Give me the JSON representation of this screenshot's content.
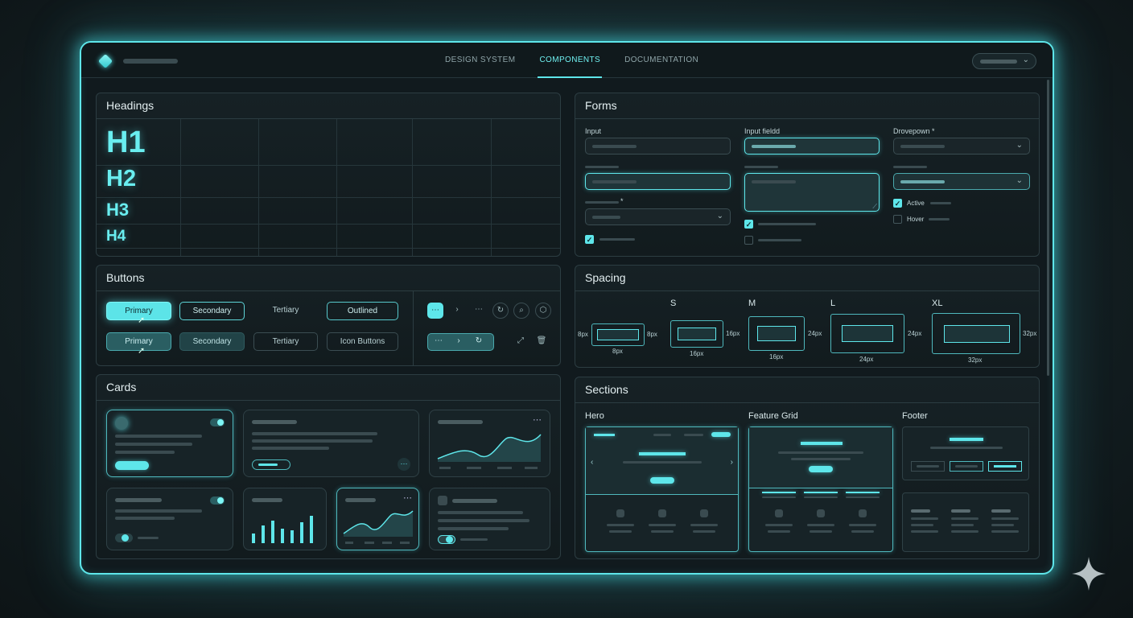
{
  "nav": {
    "tabs": [
      "DESIGN SYSTEM",
      "COMPONENTS",
      "DOCUMENTATION"
    ],
    "active": "COMPONENTS"
  },
  "headings": {
    "title": "Headings",
    "h1": "H1",
    "h2": "H2",
    "h3": "H3",
    "h4": "H4"
  },
  "buttons": {
    "title": "Buttons",
    "primary": "Primary",
    "secondary": "Secondary",
    "tertiary": "Tertiary",
    "outlined": "Outlined",
    "icon_buttons": "Icon Buttons"
  },
  "cards": {
    "title": "Cards"
  },
  "forms": {
    "title": "Forms",
    "input_label": "Input",
    "input_field_label": "Input fieldd",
    "dropdown_label": "Drovepown *",
    "required_mark": "*",
    "active_label": "Active",
    "hover_label": "Hover"
  },
  "spacing": {
    "title": "Spacing",
    "sizes": [
      "S",
      "M",
      "L",
      "XL"
    ],
    "values": [
      "8px",
      "16px",
      "24px",
      "32px"
    ]
  },
  "sections": {
    "title": "Sections",
    "hero": "Hero",
    "feature_grid": "Feature Grid",
    "footer": "Footer"
  },
  "colors": {
    "accent": "#5ee6ea",
    "background": "#111a1e",
    "panel": "#162125"
  }
}
